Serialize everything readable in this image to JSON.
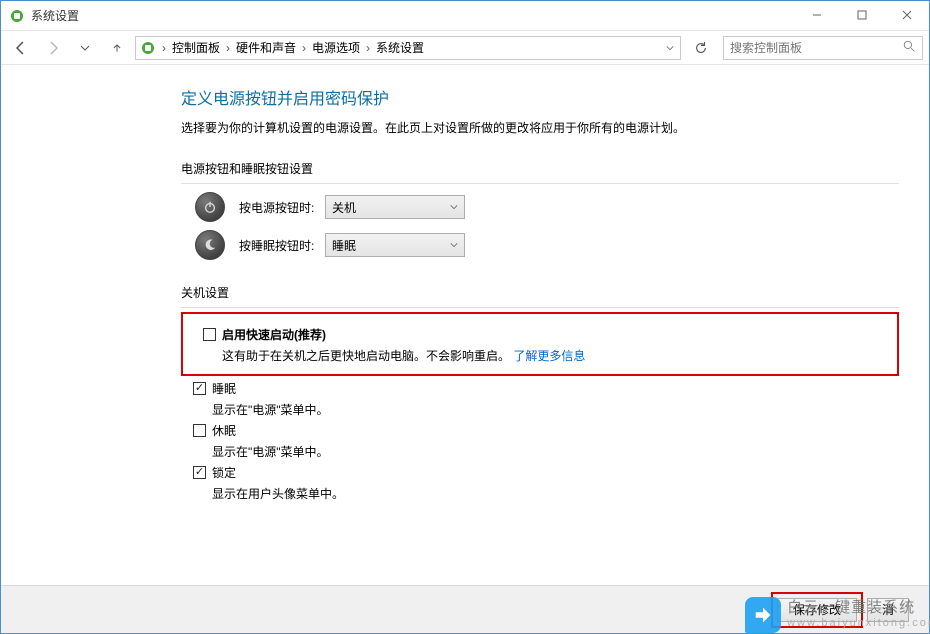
{
  "window": {
    "title": "系统设置"
  },
  "breadcrumb": {
    "items": [
      "控制面板",
      "硬件和声音",
      "电源选项",
      "系统设置"
    ]
  },
  "search": {
    "placeholder": "搜索控制面板"
  },
  "page": {
    "title": "定义电源按钮并启用密码保护",
    "desc": "选择要为你的计算机设置的电源设置。在此页上对设置所做的更改将应用于你所有的电源计划。"
  },
  "buttons_section": {
    "label": "电源按钮和睡眠按钮设置",
    "rows": [
      {
        "label": "按电源按钮时:",
        "value": "关机"
      },
      {
        "label": "按睡眠按钮时:",
        "value": "睡眠"
      }
    ]
  },
  "shutdown_section": {
    "label": "关机设置",
    "fast_startup": {
      "checked": false,
      "title": "启用快速启动(推荐)",
      "desc_prefix": "这有助于在关机之后更快地启动电脑。不会影响重启。",
      "link": "了解更多信息"
    },
    "sleep": {
      "checked": true,
      "title": "睡眠",
      "desc": "显示在\"电源\"菜单中。"
    },
    "hibernate": {
      "checked": false,
      "title": "休眠",
      "desc": "显示在\"电源\"菜单中。"
    },
    "lock": {
      "checked": true,
      "title": "锁定",
      "desc": "显示在用户头像菜单中。"
    }
  },
  "footer": {
    "save": "保存修改",
    "cancel": "消"
  },
  "watermark": {
    "main": "白云一键重装系统",
    "sub": "www.baiyunxitong.com"
  }
}
